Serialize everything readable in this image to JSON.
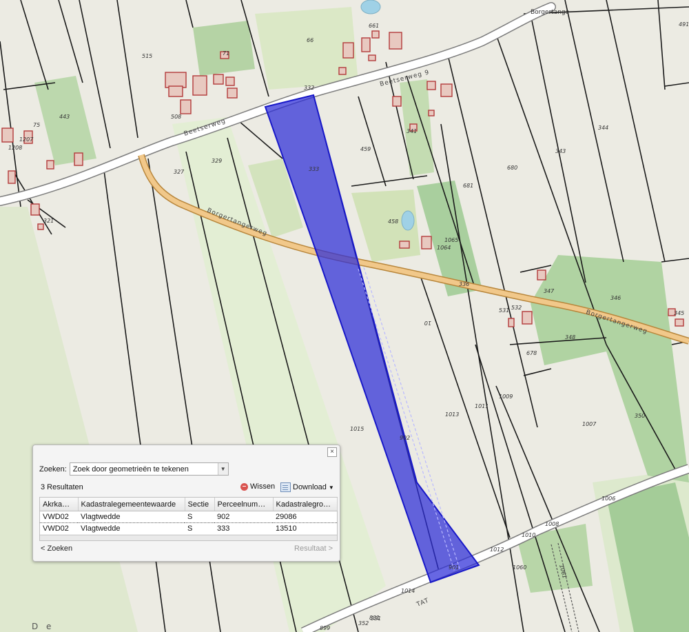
{
  "map": {
    "place_name": "Borgertange",
    "roads": [
      {
        "name": "Beetserweg",
        "number": "9"
      },
      {
        "name": "Beetserweg",
        "number": ""
      },
      {
        "name": "Borgertangerweg",
        "number": ""
      },
      {
        "name": "Borgertangerweg",
        "number": ""
      },
      {
        "name": "TAT",
        "number": ""
      }
    ],
    "road_segment_numbers": [
      "332",
      "336",
      "331",
      "352"
    ],
    "parcel_numbers": [
      "515",
      "71",
      "661",
      "66",
      "491",
      "443",
      "75",
      "1207",
      "1208",
      "508",
      "459",
      "341",
      "344",
      "343",
      "680",
      "681",
      "327",
      "329",
      "333",
      "458",
      "1065",
      "1064",
      "321",
      "347",
      "346",
      "345",
      "531",
      "532",
      "348",
      "678",
      "1009",
      "1011",
      "1013",
      "1015",
      "902",
      "1007",
      "350",
      "1006",
      "1008",
      "1010",
      "1012",
      "1060",
      "1061",
      "901",
      "1014",
      "899",
      "831",
      "10"
    ],
    "highlight_color": "#2c2cd8",
    "corner_text": "D e"
  },
  "panel": {
    "close_label": "×",
    "search_label": "Zoeken:",
    "search_mode": "Zoek door geometrieën te tekenen",
    "results_count": "3 Resultaten",
    "wissen_label": "Wissen",
    "download_label": "Download",
    "columns": [
      "Akrka…",
      "Kadastralegemeentewaarde",
      "Sectie",
      "Perceelnum…",
      "Kadastralegrootte"
    ],
    "rows": [
      {
        "akr": "VWD02",
        "gemeente": "Vlagtwedde",
        "sectie": "S",
        "perceel": "902",
        "grootte": "29086"
      },
      {
        "akr": "VWD02",
        "gemeente": "Vlagtwedde",
        "sectie": "S",
        "perceel": "333",
        "grootte": "13510"
      }
    ],
    "back_label": "< Zoeken",
    "next_label": "Resultaat >"
  }
}
